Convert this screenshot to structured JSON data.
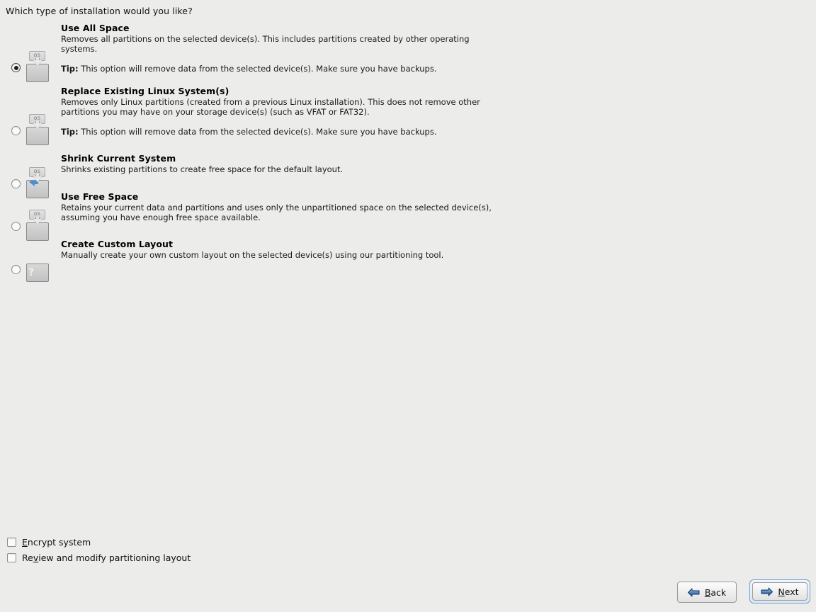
{
  "page": {
    "title": "Which type of installation would you like?"
  },
  "options": [
    {
      "id": "use-all-space",
      "title": "Use All Space",
      "description": "Removes all partitions on the selected device(s).  This includes partitions created by other operating systems.",
      "tip_label": "Tip:",
      "tip_text": " This option will remove data from the selected device(s).  Make sure you have backups.",
      "selected": true,
      "icon": "drive-os-erase-icon",
      "icon_tag": "OS"
    },
    {
      "id": "replace-existing-linux",
      "title": "Replace Existing Linux System(s)",
      "description": "Removes only Linux partitions (created from a previous Linux installation).  This does not remove other partitions you may have on your storage device(s) (such as VFAT or FAT32).",
      "tip_label": "Tip:",
      "tip_text": " This option will remove data from the selected device(s).  Make sure you have backups.",
      "selected": false,
      "icon": "drive-os-replace-icon",
      "icon_tag": "OS"
    },
    {
      "id": "shrink-current-system",
      "title": "Shrink Current System",
      "description": "Shrinks existing partitions to create free space for the default layout.",
      "tip_label": "",
      "tip_text": "",
      "selected": false,
      "icon": "drive-os-shrink-icon",
      "icon_tag": "OS"
    },
    {
      "id": "use-free-space",
      "title": "Use Free Space",
      "description": "Retains your current data and partitions and uses only the unpartitioned space on the selected device(s), assuming you have enough free space available.",
      "tip_label": "",
      "tip_text": "",
      "selected": false,
      "icon": "drive-os-freespace-icon",
      "icon_tag": "OS"
    },
    {
      "id": "create-custom-layout",
      "title": "Create Custom Layout",
      "description": "Manually create your own custom layout on the selected device(s) using our partitioning tool.",
      "tip_label": "",
      "tip_text": "",
      "selected": false,
      "icon": "drive-question-icon",
      "icon_tag": "?"
    }
  ],
  "checkboxes": [
    {
      "id": "encrypt-system",
      "mnemonic": "E",
      "rest": "ncrypt system",
      "prefix": "",
      "checked": false
    },
    {
      "id": "review-modify-partitioning",
      "mnemonic": "v",
      "rest": "iew and modify partitioning layout",
      "prefix": "Re",
      "checked": false
    }
  ],
  "buttons": {
    "back": {
      "prefix": "",
      "mnemonic": "B",
      "rest": "ack",
      "icon": "arrow-left-icon",
      "focused": false
    },
    "next": {
      "prefix": "",
      "mnemonic": "N",
      "rest": "ext",
      "icon": "arrow-right-icon",
      "focused": true
    }
  },
  "colors": {
    "background": "#ececeb",
    "accent_blue": "#3a78b5",
    "focus_blue": "#6f9fd0"
  }
}
